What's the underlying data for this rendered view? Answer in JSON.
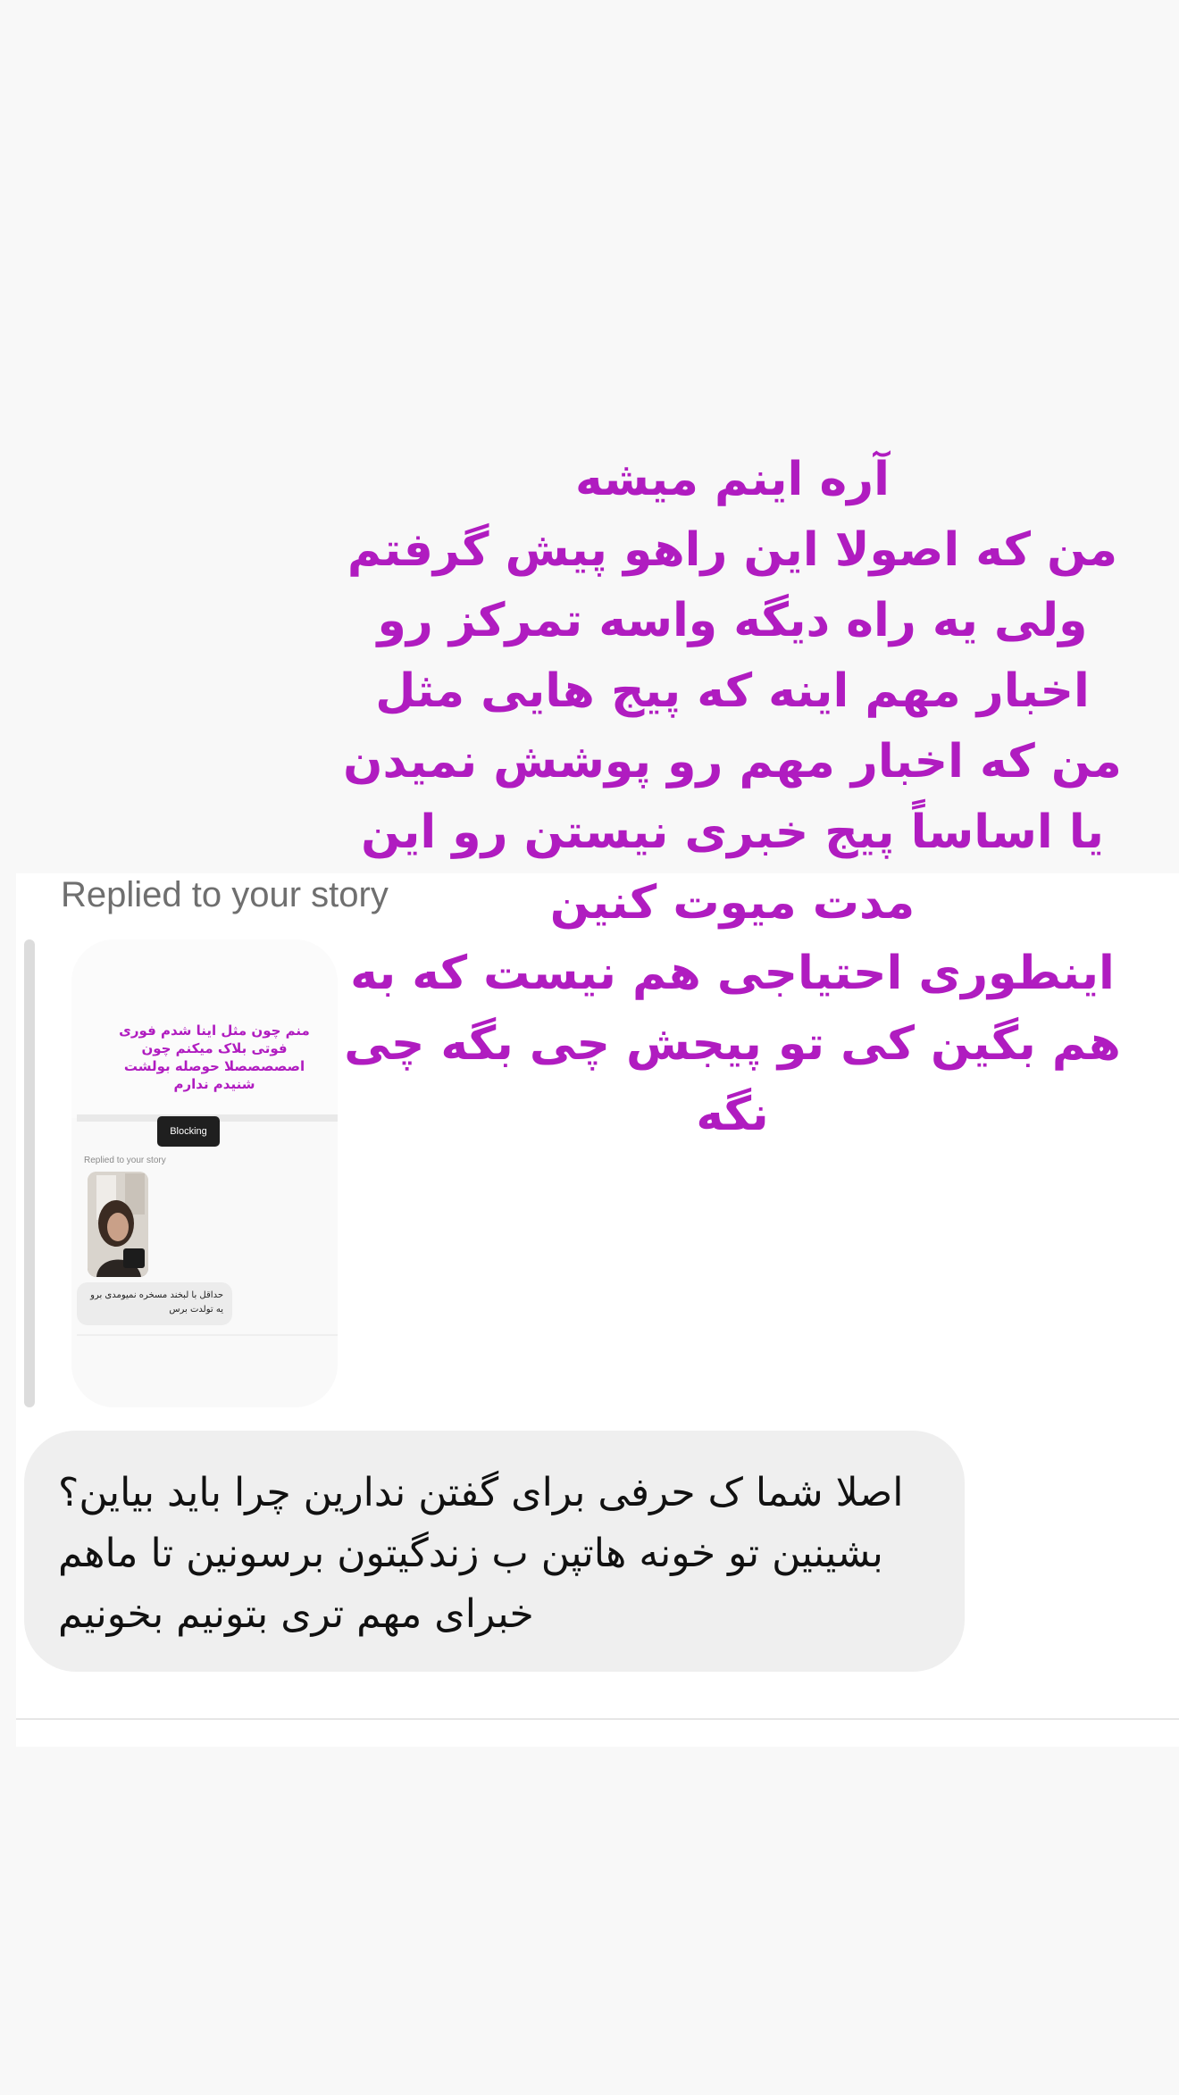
{
  "overlay": {
    "text": "آره اینم میشه\nمن که اصولا این راهو پیش گرفتم\nولی یه راه دیگه واسه تمرکز رو\nاخبار مهم اینه که پیج هایی مثل\nمن که اخبار مهم رو پوشش نمیدن\nیا اساساً پیج خبری نیستن رو این\nمدت میوت کنین\nاینطوری احتیاجی هم نیست که به\nهم بگین کی تو پیجش چی بگه چی\nنگه",
    "color": "#b01cc0"
  },
  "dm": {
    "replied_label": "Replied to your story",
    "story_preview": {
      "caption": "منم چون مثل اینا شدم فوری فوتی بلاک میکنم چون اصصصصصلا حوصله بولشت شنیدم ندارم",
      "blocking_button": "Blocking",
      "nested_replied_label": "Replied to your story",
      "nested_reply_text": "حداقل با لبخند مسخره نمیومدی برو یه تولدت برس"
    },
    "message": {
      "text": "اصلا شما ک حرفی برای گفتن ندارین چرا باید بیاین؟ بشینین تو خونه هاتپن ب زندگیتون برسونین تا ماهم خبرای مهم تری بتونیم بخونیم"
    }
  },
  "colors": {
    "page_background": "#f8f8f8",
    "card_background": "#ffffff",
    "bubble_background": "#efefef",
    "accent_purple": "#b01cc0"
  }
}
